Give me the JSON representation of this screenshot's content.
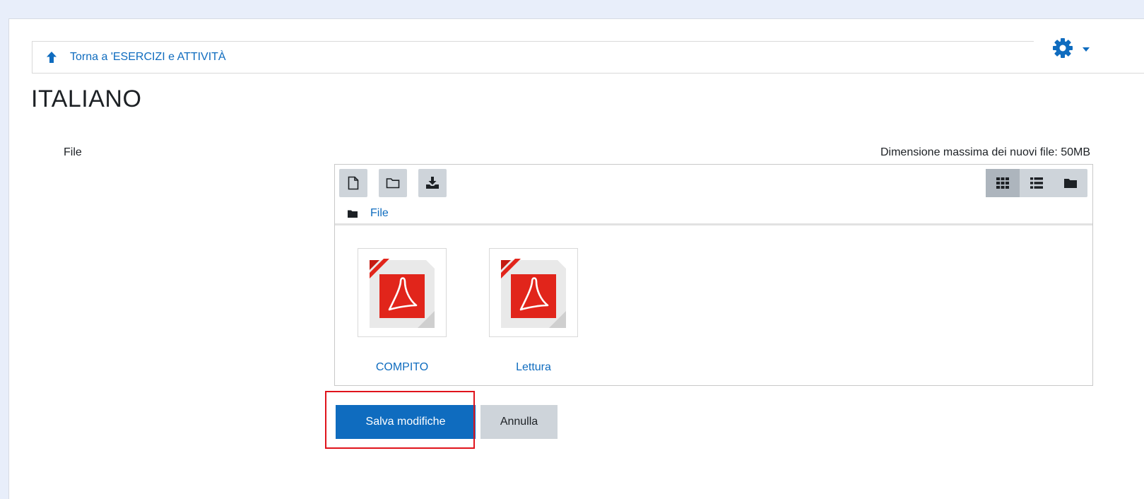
{
  "header": {
    "back_link": "Torna a 'ESERCIZI e ATTIVITÀ",
    "settings_icon": "gear-icon",
    "caret_icon": "caret-down-icon"
  },
  "page": {
    "title": "ITALIANO"
  },
  "form": {
    "field_label": "File",
    "max_size_text": "Dimensione massima dei nuovi file: 50MB"
  },
  "filepicker": {
    "toolbar": {
      "add_file_icon": "file-icon",
      "create_folder_icon": "folder-icon",
      "download_icon": "download-icon",
      "views": [
        {
          "icon": "grid-view-icon",
          "active": true
        },
        {
          "icon": "list-view-icon",
          "active": false
        },
        {
          "icon": "tree-view-icon",
          "active": false
        }
      ]
    },
    "breadcrumb": {
      "icon": "folder-icon",
      "label": "File"
    },
    "files": [
      {
        "name": "COMPITO",
        "icon": "pdf-icon"
      },
      {
        "name": "Lettura",
        "icon": "pdf-icon"
      }
    ]
  },
  "buttons": {
    "save": "Salva modifiche",
    "cancel": "Annulla"
  },
  "colors": {
    "link": "#0f6cbf",
    "primary": "#0f6cbf",
    "secondary": "#ced4da",
    "highlight": "#e0141c",
    "pdf_red": "#e1251b"
  }
}
